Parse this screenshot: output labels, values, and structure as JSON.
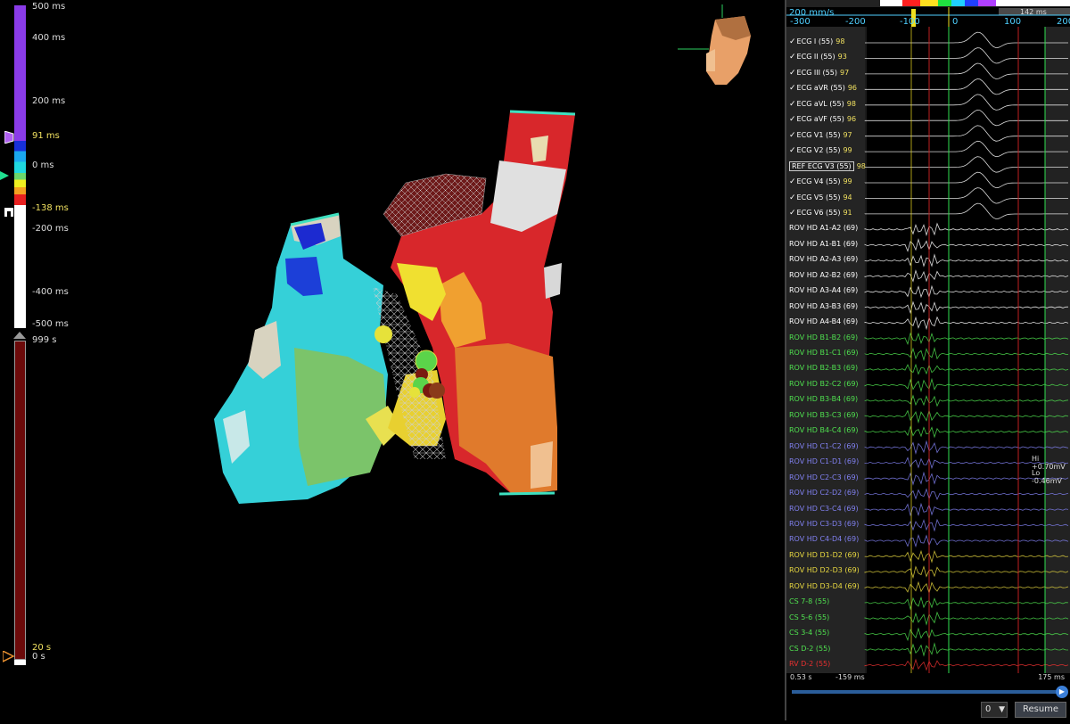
{
  "color_scale": {
    "labels": [
      "500 ms",
      "400 ms",
      "200 ms",
      "91 ms",
      "0 ms",
      "-138 ms",
      "-200 ms",
      "-400 ms",
      "-500 ms"
    ],
    "colors": {
      "upper": "#8a3be8",
      "lower": "#ffffff",
      "bands": [
        "#1730d8",
        "#1aa8f0",
        "#1fd8e0",
        "#6bd66b",
        "#f0f020",
        "#f5a020",
        "#e82020"
      ]
    }
  },
  "time_scale": {
    "labels": [
      "999 s",
      "20 s",
      "0 s"
    ],
    "color": "#6b0a0a"
  },
  "signal_panel": {
    "speed": "200 mm/s",
    "ticks": [
      "-300",
      "-200",
      "-100",
      "0",
      "100",
      "200"
    ],
    "header_ms": "142 ms",
    "channels": [
      {
        "checked": true,
        "label": "ECG I (55)",
        "score": "98",
        "color": "#ffffff"
      },
      {
        "checked": true,
        "label": "ECG II (55)",
        "score": "93",
        "color": "#ffffff"
      },
      {
        "checked": true,
        "label": "ECG III (55)",
        "score": "97",
        "color": "#ffffff"
      },
      {
        "checked": true,
        "label": "ECG aVR (55)",
        "score": "96",
        "color": "#ffffff"
      },
      {
        "checked": true,
        "label": "ECG aVL (55)",
        "score": "98",
        "color": "#ffffff"
      },
      {
        "checked": true,
        "label": "ECG aVF (55)",
        "score": "96",
        "color": "#ffffff"
      },
      {
        "checked": true,
        "label": "ECG V1 (55)",
        "score": "97",
        "color": "#ffffff"
      },
      {
        "checked": true,
        "label": "ECG V2 (55)",
        "score": "99",
        "color": "#ffffff"
      },
      {
        "checked": false,
        "ref": "REF",
        "label": "ECG V3 (55)",
        "score": "98",
        "color": "#ffffff"
      },
      {
        "checked": true,
        "label": "ECG V4 (55)",
        "score": "99",
        "color": "#ffffff"
      },
      {
        "checked": true,
        "label": "ECG V5 (55)",
        "score": "94",
        "color": "#ffffff"
      },
      {
        "checked": true,
        "label": "ECG V6 (55)",
        "score": "91",
        "color": "#ffffff"
      },
      {
        "label": "ROV HD   A1-A2 (69)",
        "color": "#ffffff"
      },
      {
        "label": "ROV HD   A1-B1 (69)",
        "color": "#ffffff"
      },
      {
        "label": "ROV HD   A2-A3 (69)",
        "color": "#ffffff"
      },
      {
        "label": "ROV HD   A2-B2 (69)",
        "color": "#ffffff"
      },
      {
        "label": "ROV HD   A3-A4 (69)",
        "color": "#ffffff"
      },
      {
        "label": "ROV HD   A3-B3 (69)",
        "color": "#ffffff"
      },
      {
        "label": "ROV HD   A4-B4 (69)",
        "color": "#ffffff"
      },
      {
        "label": "ROV HD   B1-B2 (69)",
        "color": "#4fe04f"
      },
      {
        "label": "ROV HD   B1-C1 (69)",
        "color": "#4fe04f"
      },
      {
        "label": "ROV HD   B2-B3 (69)",
        "color": "#4fe04f"
      },
      {
        "label": "ROV HD   B2-C2 (69)",
        "color": "#4fe04f"
      },
      {
        "label": "ROV HD   B3-B4 (69)",
        "color": "#4fe04f"
      },
      {
        "label": "ROV HD   B3-C3 (69)",
        "color": "#4fe04f"
      },
      {
        "label": "ROV HD   B4-C4 (69)",
        "color": "#4fe04f"
      },
      {
        "label": "ROV HD   C1-C2 (69)",
        "color": "#8080f0"
      },
      {
        "label": "ROV HD   C1-D1 (69)",
        "color": "#8080f0"
      },
      {
        "label": "ROV HD   C2-C3 (69)",
        "color": "#8080f0"
      },
      {
        "label": "ROV HD   C2-D2 (69)",
        "color": "#8080f0"
      },
      {
        "label": "ROV HD   C3-C4 (69)",
        "color": "#8080f0"
      },
      {
        "label": "ROV HD   C3-D3 (69)",
        "color": "#8080f0"
      },
      {
        "label": "ROV HD   C4-D4 (69)",
        "color": "#8080f0"
      },
      {
        "label": "ROV HD   D1-D2 (69)",
        "color": "#e8d840"
      },
      {
        "label": "ROV HD   D2-D3 (69)",
        "color": "#e8d840"
      },
      {
        "label": "ROV HD   D3-D4 (69)",
        "color": "#e8d840"
      },
      {
        "label": "CS  7-8 (55)",
        "color": "#4fe04f"
      },
      {
        "label": "CS  5-6 (55)",
        "color": "#4fe04f"
      },
      {
        "label": "CS  3-4 (55)",
        "color": "#4fe04f"
      },
      {
        "label": "CS  D-2 (55)",
        "color": "#4fe04f"
      },
      {
        "label": "RV  D-2 (55)",
        "color": "#e83030"
      }
    ],
    "annotations": {
      "hi": "Hi +0.70mV",
      "lo": "Lo -0.46mV"
    },
    "footer": {
      "time_left": "0.53 s",
      "time_mid": "-159 ms",
      "time_right": "175 ms",
      "zoom_value": "0",
      "resume_label": "Resume",
      "play_icon": "▶"
    }
  }
}
